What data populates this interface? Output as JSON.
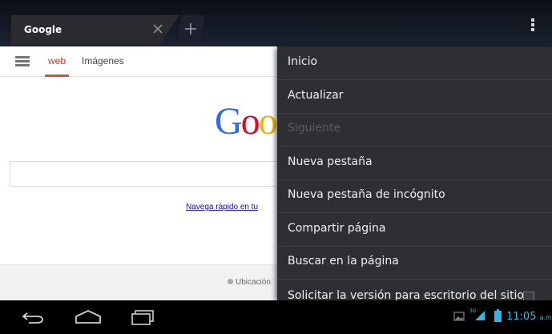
{
  "tab": {
    "title": "Google"
  },
  "google": {
    "tabs": [
      "web",
      "Imágenes"
    ],
    "logo_visible": "Goo",
    "promo_link": "Navega rápido en tu",
    "footer_location": "Ubicación"
  },
  "menu": {
    "items": [
      {
        "label": "Inicio",
        "enabled": true
      },
      {
        "label": "Actualizar",
        "enabled": true
      },
      {
        "label": "Siguiente",
        "enabled": false
      },
      {
        "label": "Nueva pestaña",
        "enabled": true
      },
      {
        "label": "Nueva pestaña de incógnito",
        "enabled": true
      },
      {
        "label": "Compartir página",
        "enabled": true
      },
      {
        "label": "Buscar en la página",
        "enabled": true
      },
      {
        "label": "Solicitar la versión para escritorio del sitio",
        "enabled": true,
        "checkbox": false
      }
    ]
  },
  "system": {
    "network": "3G",
    "time": "11:05",
    "ampm": "a.m"
  },
  "colors": {
    "accent_blue": "#33b5e5",
    "google_red": "#dd4b39",
    "menu_bg": "#2d2f33"
  }
}
